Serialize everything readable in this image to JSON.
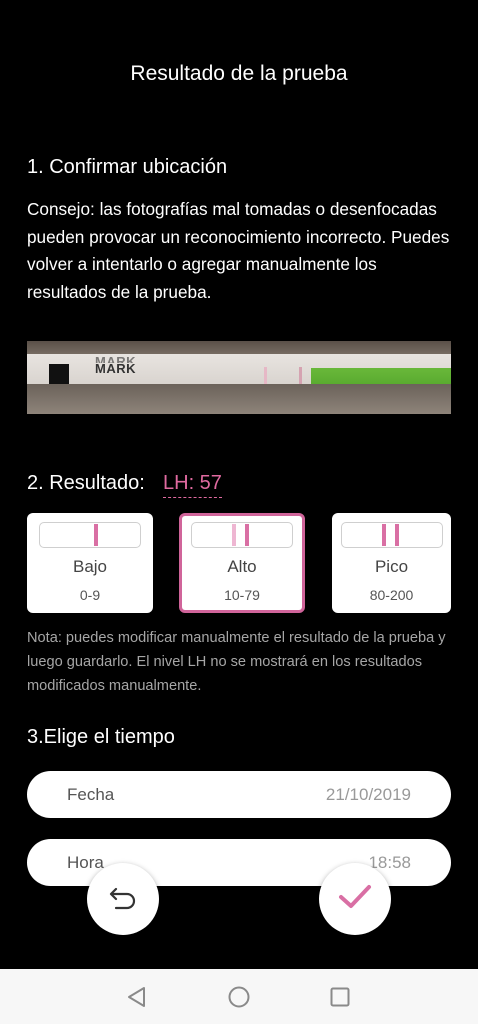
{
  "header": {
    "title": "Resultado de la prueba"
  },
  "step1": {
    "title": "1. Confirmar ubicación",
    "tip": "Consejo: las fotografías mal tomadas o desenfocadas pueden provocar un reconocimiento incorrecto. Puedes volver a intentarlo o agregar manualmente los resultados de la prueba.",
    "strip_text_top": "MARK",
    "strip_text": "MARK"
  },
  "step2": {
    "title": "2. Resultado:",
    "lh_value": "LH: 57",
    "options": [
      {
        "label": "Bajo",
        "range": "0-9",
        "selected": false
      },
      {
        "label": "Alto",
        "range": "10-79",
        "selected": true
      },
      {
        "label": "Pico",
        "range": "80-200",
        "selected": false
      }
    ],
    "note": "Nota: puedes modificar manualmente el resultado de la prueba y luego guardarlo. El nivel LH no se mostrará en los resultados modificados manualmente."
  },
  "step3": {
    "title": "3.Elige el tiempo",
    "date_label": "Fecha",
    "date_value": "21/10/2019",
    "time_label": "Hora",
    "time_value": "18:58"
  },
  "actions": {
    "undo_icon": "undo-icon",
    "confirm_icon": "check-icon"
  },
  "colors": {
    "accent": "#d96fa4",
    "background": "#000000",
    "note": "#a6a6a6"
  },
  "system_nav": {
    "back_icon": "back-triangle-icon",
    "home_icon": "home-circle-icon",
    "recents_icon": "recents-square-icon"
  }
}
